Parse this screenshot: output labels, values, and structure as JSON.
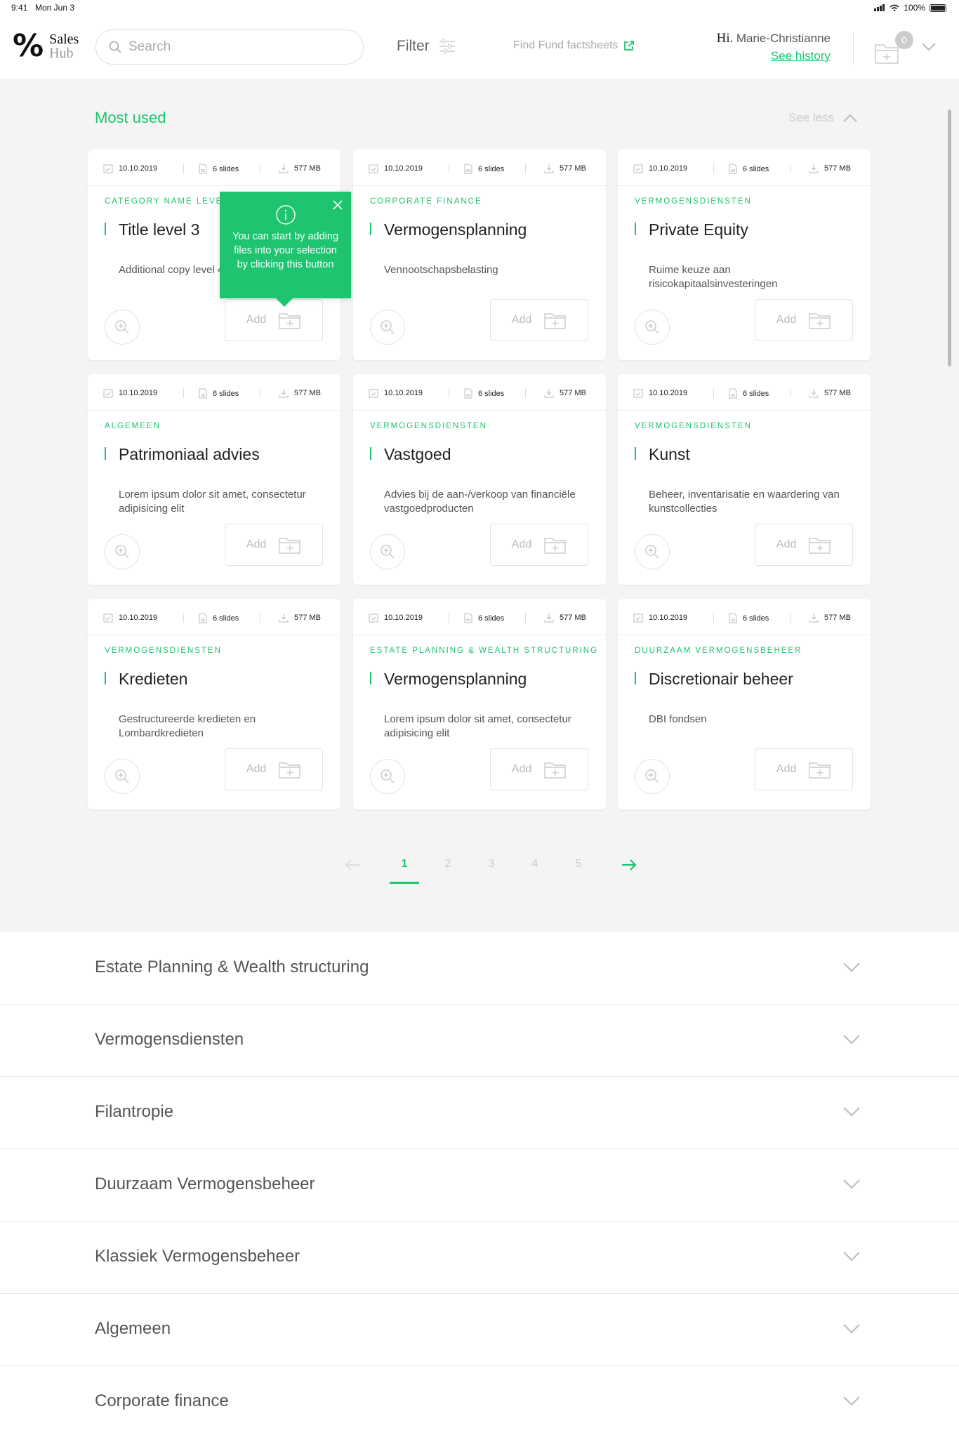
{
  "status_bar": {
    "time": "9:41",
    "date": "Mon Jun 3",
    "battery": "100%"
  },
  "header": {
    "logo_line1": "Sales",
    "logo_line2": "Hub",
    "search_placeholder": "Search",
    "filter_label": "Filter",
    "factsheets_label": "Find Fund factsheets",
    "greeting_hi": "Hi.",
    "user_name": "Marie-Christianne",
    "history_link": "See history",
    "basket_count": "0"
  },
  "most_used": {
    "title": "Most used",
    "see_less": "See less",
    "add_label": "Add",
    "cards": [
      {
        "date": "10.10.2019",
        "slides": "6 slides",
        "size": "577 MB",
        "category": "CATEGORY NAME LEVEL 2",
        "title": "Title level 3",
        "description": "Additional copy level 4"
      },
      {
        "date": "10.10.2019",
        "slides": "6 slides",
        "size": "577 MB",
        "category": "CORPORATE FINANCE",
        "title": "Vermogensplanning",
        "description": "Vennootschapsbelasting"
      },
      {
        "date": "10.10.2019",
        "slides": "6 slides",
        "size": "577 MB",
        "category": "VERMOGENSDIENSTEN",
        "title": "Private Equity",
        "description": "Ruime keuze aan risicokapitaalsinvesteringen"
      },
      {
        "date": "10.10.2019",
        "slides": "6 slides",
        "size": "577 MB",
        "category": "ALGEMEEN",
        "title": "Patrimoniaal advies",
        "description": "Lorem ipsum dolor sit amet, consectetur adipisicing elit"
      },
      {
        "date": "10.10.2019",
        "slides": "6 slides",
        "size": "577 MB",
        "category": "VERMOGENSDIENSTEN",
        "title": "Vastgoed",
        "description": "Advies bij de aan-/verkoop van financiële vastgoedproducten"
      },
      {
        "date": "10.10.2019",
        "slides": "6 slides",
        "size": "577 MB",
        "category": "VERMOGENSDIENSTEN",
        "title": "Kunst",
        "description": "Beheer, inventarisatie en waardering van kunstcollecties"
      },
      {
        "date": "10.10.2019",
        "slides": "6 slides",
        "size": "577 MB",
        "category": "VERMOGENSDIENSTEN",
        "title": "Kredieten",
        "description": "Gestructureerde kredieten en Lombardkredieten"
      },
      {
        "date": "10.10.2019",
        "slides": "6 slides",
        "size": "577 MB",
        "category": "ESTATE PLANNING & WEALTH STRUCTURING",
        "title": "Vermogensplanning",
        "description": "Lorem ipsum dolor sit amet, consectetur adipisicing elit"
      },
      {
        "date": "10.10.2019",
        "slides": "6 slides",
        "size": "577 MB",
        "category": "DUURZAAM VERMOGENSBEHEER",
        "title": "Discretionair beheer",
        "description": "DBI fondsen"
      }
    ]
  },
  "tooltip": {
    "text": "You can start by adding files into your selection by clicking this button"
  },
  "pagination": {
    "pages": [
      "1",
      "2",
      "3",
      "4",
      "5"
    ],
    "current": "1"
  },
  "accordion": [
    "Estate Planning & Wealth structuring",
    "Vermogensdiensten",
    "Filantropie",
    "Duurzaam Vermogensbeheer",
    "Klassiek Vermogensbeheer",
    "Algemeen",
    "Corporate finance"
  ],
  "colors": {
    "accent": "#1ec46f",
    "background": "#f4f4f4"
  }
}
